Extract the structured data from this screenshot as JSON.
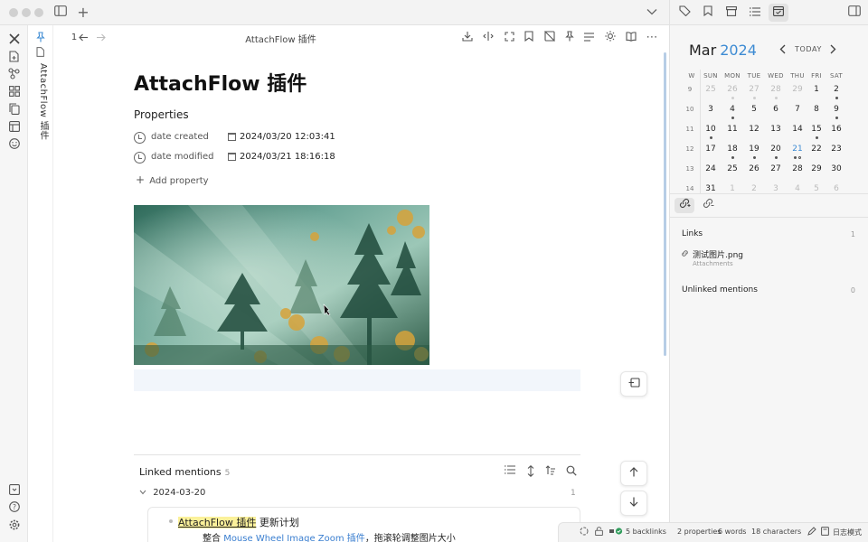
{
  "titlebar": {
    "icons": [
      "sidebar-toggle-icon",
      "new-tab-icon",
      "chevron-down-icon"
    ],
    "right_tabs": [
      "tags-icon",
      "bookmark-icon",
      "archive-icon",
      "outline-icon",
      "calendar-icon"
    ],
    "right_sidebar_toggle": "sidebar-right-icon"
  },
  "ribbon": {
    "top_icons": [
      "close-icon",
      "file-plus-icon",
      "graph-icon",
      "grid-icon",
      "copy-icon",
      "template-icon",
      "smile-icon"
    ],
    "bottom_icons": [
      "vault-icon",
      "help-icon",
      "settings-icon"
    ]
  },
  "pinned_strip": {
    "label": "AttachFlow 插件"
  },
  "view_header": {
    "page_count": "1",
    "title": "AttachFlow 插件",
    "actions": [
      "download-icon",
      "split-icon",
      "fullscreen-icon",
      "bookmark-icon",
      "no-image-icon",
      "pin-icon",
      "list-icon",
      "sun-icon",
      "book-icon",
      "more-icon"
    ]
  },
  "note": {
    "title": "AttachFlow 插件",
    "properties_heading": "Properties",
    "properties": [
      {
        "name": "date created",
        "value": "2024/03/20  12:03:41"
      },
      {
        "name": "date modified",
        "value": "2024/03/21  18:16:18"
      }
    ],
    "add_property": "Add property"
  },
  "linked_mentions": {
    "title": "Linked mentions",
    "count": "5",
    "group_date": "2024-03-20",
    "group_count": "1",
    "item_highlight": "AttachFlow 插件",
    "item_rest": " 更新计划",
    "sub_prefix": "整合 ",
    "sub_link": "Mouse Wheel Image Zoom 插件",
    "sub_suffix": "，拖滚轮调整图片大小"
  },
  "calendar": {
    "month": "Mar",
    "year": "2024",
    "today_label": "TODAY",
    "weekday_headers": [
      "W",
      "SUN",
      "MON",
      "TUE",
      "WED",
      "THU",
      "FRI",
      "SAT"
    ],
    "weeks": [
      {
        "week": "9",
        "days": [
          {
            "d": "25",
            "o": true,
            "dots": 0
          },
          {
            "d": "26",
            "o": true,
            "dots": 1
          },
          {
            "d": "27",
            "o": true,
            "dots": 1
          },
          {
            "d": "28",
            "o": true,
            "dots": 1
          },
          {
            "d": "29",
            "o": true,
            "dots": 0
          },
          {
            "d": "1",
            "dots": 0
          },
          {
            "d": "2",
            "dots": 1
          }
        ]
      },
      {
        "week": "10",
        "days": [
          {
            "d": "3",
            "dots": 0
          },
          {
            "d": "4",
            "dots": 1
          },
          {
            "d": "5",
            "dots": 0
          },
          {
            "d": "6",
            "dots": 0
          },
          {
            "d": "7",
            "dots": 0
          },
          {
            "d": "8",
            "dots": 0
          },
          {
            "d": "9",
            "dots": 1
          }
        ]
      },
      {
        "week": "11",
        "days": [
          {
            "d": "10",
            "dots": 1
          },
          {
            "d": "11",
            "dots": 0
          },
          {
            "d": "12",
            "dots": 0
          },
          {
            "d": "13",
            "dots": 0
          },
          {
            "d": "14",
            "dots": 0
          },
          {
            "d": "15",
            "dots": 1
          },
          {
            "d": "16",
            "dots": 0
          }
        ]
      },
      {
        "week": "12",
        "days": [
          {
            "d": "17",
            "dots": 0
          },
          {
            "d": "18",
            "dots": 1
          },
          {
            "d": "19",
            "dots": 1
          },
          {
            "d": "20",
            "dots": 1
          },
          {
            "d": "21",
            "today": true,
            "dots": 2
          },
          {
            "d": "22",
            "dots": 0
          },
          {
            "d": "23",
            "dots": 0
          }
        ]
      },
      {
        "week": "13",
        "days": [
          {
            "d": "24",
            "dots": 0
          },
          {
            "d": "25",
            "dots": 0
          },
          {
            "d": "26",
            "dots": 0
          },
          {
            "d": "27",
            "dots": 0
          },
          {
            "d": "28",
            "dots": 0
          },
          {
            "d": "29",
            "dots": 0
          },
          {
            "d": "30",
            "dots": 0
          }
        ]
      },
      {
        "week": "14",
        "days": [
          {
            "d": "31",
            "dots": 0
          },
          {
            "d": "1",
            "o": true,
            "dots": 0
          },
          {
            "d": "2",
            "o": true,
            "dots": 0
          },
          {
            "d": "3",
            "o": true,
            "dots": 0
          },
          {
            "d": "4",
            "o": true,
            "dots": 0
          },
          {
            "d": "5",
            "o": true,
            "dots": 0
          },
          {
            "d": "6",
            "o": true,
            "dots": 0
          }
        ]
      }
    ]
  },
  "backlinks": {
    "links_title": "Links",
    "links_count": "1",
    "link_name": "测试图片.png",
    "link_path": "Attachments",
    "unlinked_title": "Unlinked mentions",
    "unlinked_count": "0"
  },
  "statusbar": {
    "backlinks": "5 backlinks",
    "properties": "2 properties",
    "words": "6 words",
    "characters": "18 characters",
    "mode": "日志模式"
  },
  "colors": {
    "accent": "#3d8bd3",
    "highlight": "#fbf19a",
    "link": "#3b7fd0"
  }
}
